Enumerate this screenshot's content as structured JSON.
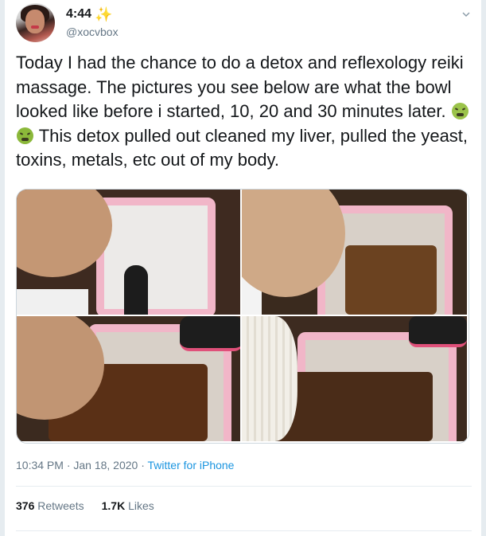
{
  "tweet": {
    "display_name": "4:44",
    "name_emoji": "✨",
    "handle": "@xocvbox",
    "text_part1": "Today I had the chance to do a detox and reflexology reiki massage. The pictures you see below are what the bowl looked like before i started, 10, 20 and 30 minutes later. ",
    "text_part2": " This detox pulled out cleaned my liver, pulled the yeast, toxins, metals, etc out of my body.",
    "emojis": [
      "sneezing-face",
      "nauseated-face"
    ],
    "timestamp": "10:34 PM · Jan 18, 2020",
    "separator": " · ",
    "source": "Twitter for iPhone",
    "retweets_count": "376",
    "retweets_label": "Retweets",
    "likes_count": "1.7K",
    "likes_label": "Likes"
  },
  "colors": {
    "link": "#1b95e0",
    "secondary_text": "#657786",
    "primary_text": "#14171a",
    "background": "#e6ecf0"
  }
}
